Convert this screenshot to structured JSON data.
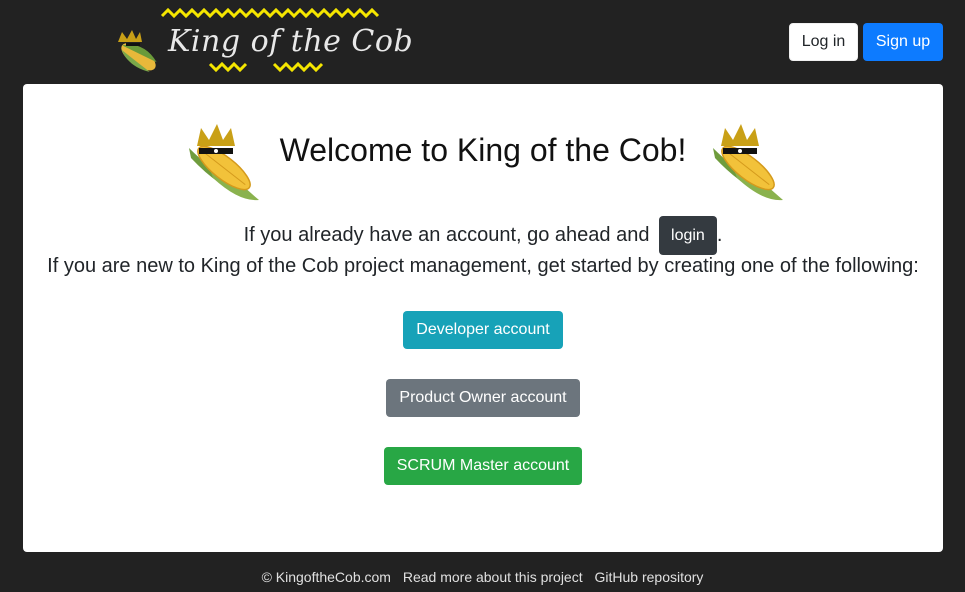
{
  "header": {
    "logo_text": "King of the Cob",
    "login_label": "Log in",
    "signup_label": "Sign up"
  },
  "main": {
    "title": "Welcome to King of the Cob!",
    "line1_before": "If you already have an account, go ahead and",
    "line1_button": "login",
    "line1_after": ".",
    "line2": "If you are new to King of the Cob project management, get started by creating one of the following:",
    "buttons": {
      "developer": "Developer account",
      "product_owner": "Product Owner account",
      "scrum_master": "SCRUM Master account"
    }
  },
  "footer": {
    "copyright": "© KingoftheCob.com",
    "read_more": "Read more about this project",
    "github": "GitHub repository"
  },
  "colors": {
    "background": "#222222",
    "signup": "#0d7bff",
    "developer": "#17a2b8",
    "product_owner": "#6c757d",
    "scrum_master": "#28a745",
    "login_inline": "#343a40",
    "logo_zigzag": "#f5e600"
  },
  "icons": [
    "corn-king-logo-icon",
    "corn-king-mascot-icon"
  ]
}
